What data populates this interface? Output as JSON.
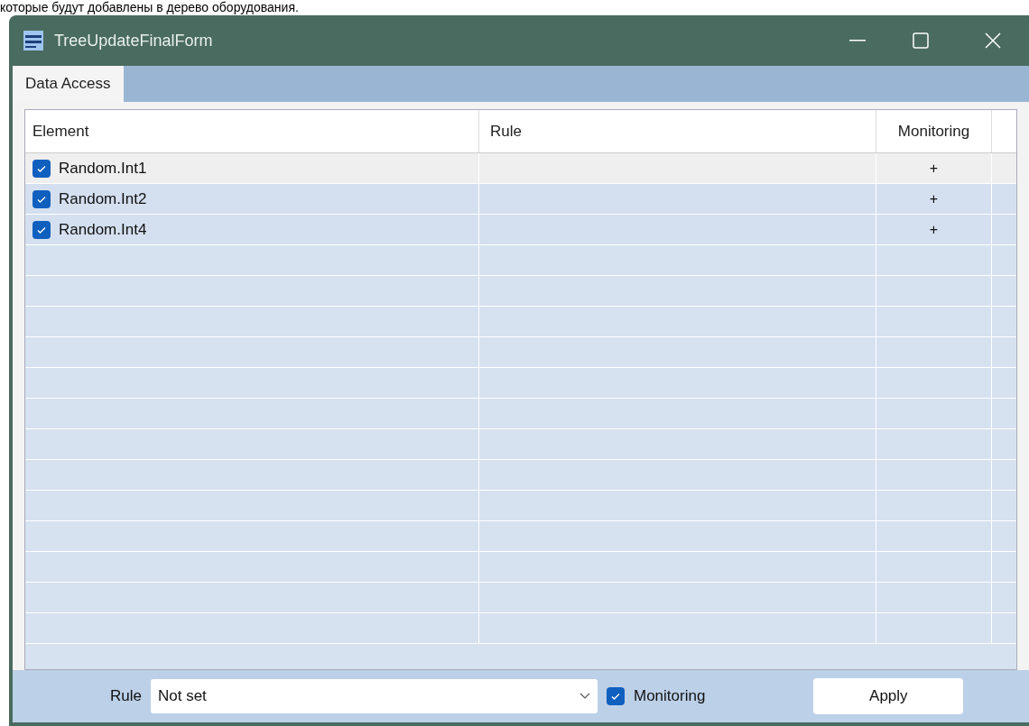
{
  "caption": "которые будут добавлены в дерево оборудования.",
  "window": {
    "title": "TreeUpdateFinalForm"
  },
  "tabs": [
    {
      "label": "Data Access",
      "selected": true
    }
  ],
  "table": {
    "columns": [
      "Element",
      "Rule",
      "Monitoring"
    ],
    "rows": [
      {
        "element": "Random.Int1",
        "checked": true,
        "monitoring": "+",
        "selected": true
      },
      {
        "element": "Random.Int2",
        "checked": true,
        "monitoring": "+",
        "selected": false
      },
      {
        "element": "Random.Int4",
        "checked": true,
        "monitoring": "+",
        "selected": false
      }
    ]
  },
  "footer": {
    "rule_label": "Rule",
    "rule_value": "Not set",
    "monitoring": {
      "label": "Monitoring",
      "checked": true
    },
    "apply": "Apply"
  }
}
